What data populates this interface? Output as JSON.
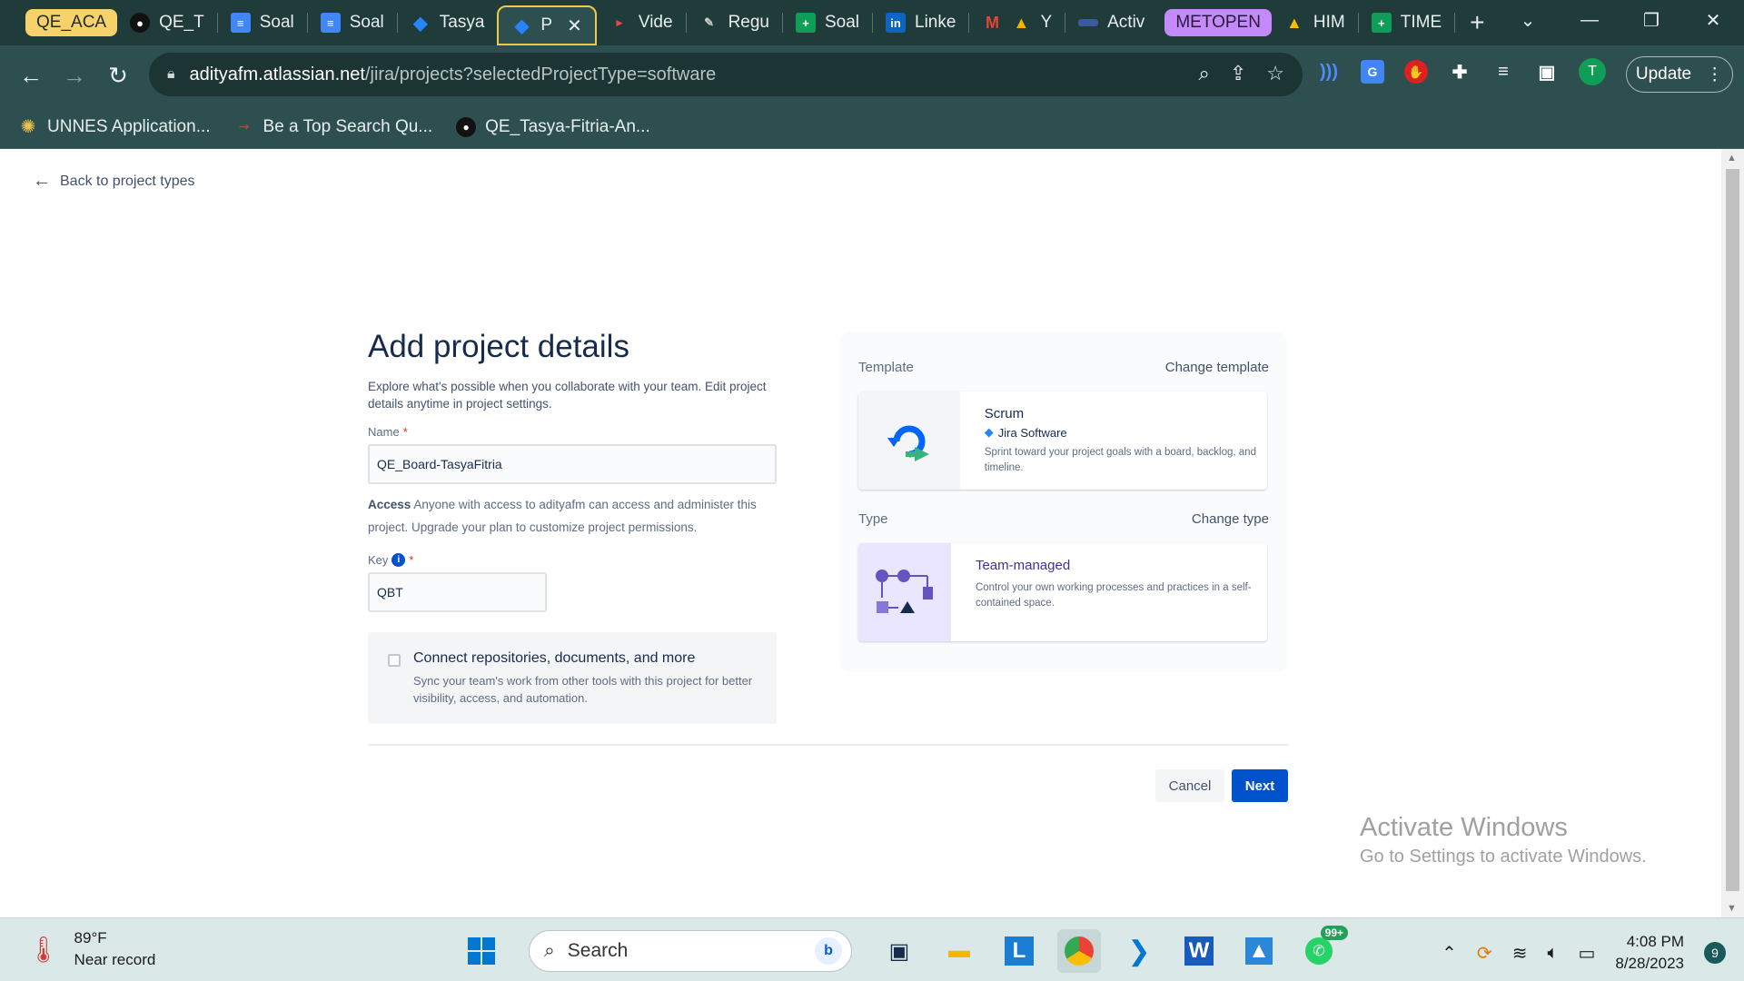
{
  "browser": {
    "tabs": [
      {
        "label": "QE_ACA",
        "kind": "group-yellow"
      },
      {
        "label": "QE_T",
        "icon": "github-icon"
      },
      {
        "label": "Soal",
        "icon": "docs-icon"
      },
      {
        "label": "Soal",
        "icon": "docs-icon"
      },
      {
        "label": "Tasya",
        "icon": "jira-icon"
      },
      {
        "label": "P",
        "icon": "jira-icon",
        "active": true
      },
      {
        "label": "Vide",
        "icon": "video-icon"
      },
      {
        "label": "Regu",
        "icon": "tool-icon"
      },
      {
        "label": "Soal",
        "icon": "sheets-icon"
      },
      {
        "label": "Linke",
        "icon": "linkedin-icon"
      },
      {
        "label": "Y",
        "icon": "gmail-icon"
      },
      {
        "label": "Activ",
        "icon": "page-icon"
      },
      {
        "label": "METOPEN",
        "kind": "group-purple"
      },
      {
        "label": "HIM",
        "icon": "drive-icon"
      },
      {
        "label": "TIME",
        "icon": "sheets-icon"
      }
    ],
    "url_host": "adityafm.atlassian.net",
    "url_path": "/jira/projects?selectedProjectType=software",
    "update_label": "Update",
    "profile_initial": "T",
    "bookmarks": [
      {
        "label": "UNNES Application..."
      },
      {
        "label": "Be a Top Search Qu..."
      },
      {
        "label": "QE_Tasya-Fitria-An..."
      }
    ]
  },
  "page": {
    "back_label": "Back to project types",
    "title": "Add project details",
    "subtitle": "Explore what's possible when you collaborate with your team. Edit project details anytime in project settings.",
    "name_label": "Name",
    "name_value": "QE_Board-TasyaFitria",
    "access_label": "Access",
    "access_text": "Anyone with access to adityafm can access and administer this project. Upgrade your plan to customize project permissions.",
    "key_label": "Key",
    "key_value": "QBT",
    "connect_title": "Connect repositories, documents, and more",
    "connect_desc": "Sync your team's work from other tools with this project for better visibility, access, and automation.",
    "template_label": "Template",
    "change_template": "Change template",
    "template_name": "Scrum",
    "template_product": "Jira Software",
    "template_desc": "Sprint toward your project goals with a board, backlog, and timeline.",
    "type_label": "Type",
    "change_type": "Change type",
    "type_name": "Team-managed",
    "type_desc": "Control your own working processes and practices in a self-contained space.",
    "cancel_label": "Cancel",
    "next_label": "Next",
    "watermark_title": "Activate Windows",
    "watermark_sub": "Go to Settings to activate Windows."
  },
  "taskbar": {
    "temp": "89°F",
    "weather": "Near record",
    "search_label": "Search",
    "whatsapp_badge": "99+",
    "time": "4:08 PM",
    "date": "8/28/2023",
    "notifications": "9"
  }
}
